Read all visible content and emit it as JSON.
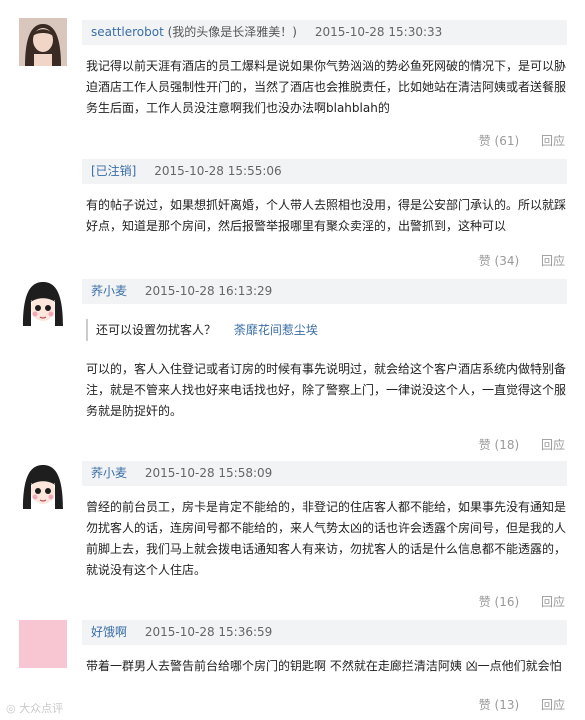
{
  "comments": [
    {
      "username": "seattlerobot",
      "note": "(我的头像是长泽雅美！)",
      "time": "2015-10-28 15:30:33",
      "body": "我记得以前天涯有酒店的员工爆料是说如果你气势汹汹的势必鱼死网破的情况下，是可以胁迫酒店工作人员强制性开门的，当然了酒店也会推脱责任，比如她站在清洁阿姨或者送餐服务生后面，工作人员没注意啊我们也没办法啊blahblah的",
      "likes": "赞 (61)",
      "reply": "回应"
    },
    {
      "username": "[已注销]",
      "time": "2015-10-28 15:55:06",
      "body": "有的帖子说过，如果想抓奸离婚，个人带人去照相也没用，得是公安部门承认的。所以就踩好点，知道是那个房间，然后报警举报哪里有聚众卖淫的，出警抓到，这种可以",
      "likes": "赞 (34)",
      "reply": "回应"
    },
    {
      "username": "荞小麦",
      "time": "2015-10-28 16:13:29",
      "quote_text": "还可以设置勿扰客人？",
      "quote_author": "荼靡花间惹尘埃",
      "body": "可以的，客人入住登记或者订房的时候有事先说明过，就会给这个客户酒店系统内做特别备注，就是不管来人找也好来电话找也好，除了警察上门，一律说没这个人，一直觉得这个服务就是防捉奸的。",
      "likes": "赞 (18)",
      "reply": "回应"
    },
    {
      "username": "荞小麦",
      "time": "2015-10-28 15:58:09",
      "body": "曾经的前台员工，房卡是肯定不能给的，非登记的住店客人都不能给，如果事先没有通知是勿扰客人的话，连房间号都不能给的，来人气势太凶的话也许会透露个房间号，但是我的人前脚上去，我们马上就会拨电话通知客人有来访，勿扰客人的话是什么信息都不能透露的，就说没有这个人住店。",
      "likes": "赞 (16)",
      "reply": "回应"
    },
    {
      "username": "好饿啊",
      "time": "2015-10-28 15:36:59",
      "body": "带着一群男人去警告前台给哪个房门的钥匙啊 不然就在走廊拦清洁阿姨 凶一点他们就会怕",
      "likes": "赞 (13)",
      "reply": "回应"
    }
  ],
  "watermark": "大众点评",
  "colors": {
    "username": "#3a6ea5",
    "header_bg": "#f2f3f5",
    "avatar_pink": "#f8c6d2"
  }
}
